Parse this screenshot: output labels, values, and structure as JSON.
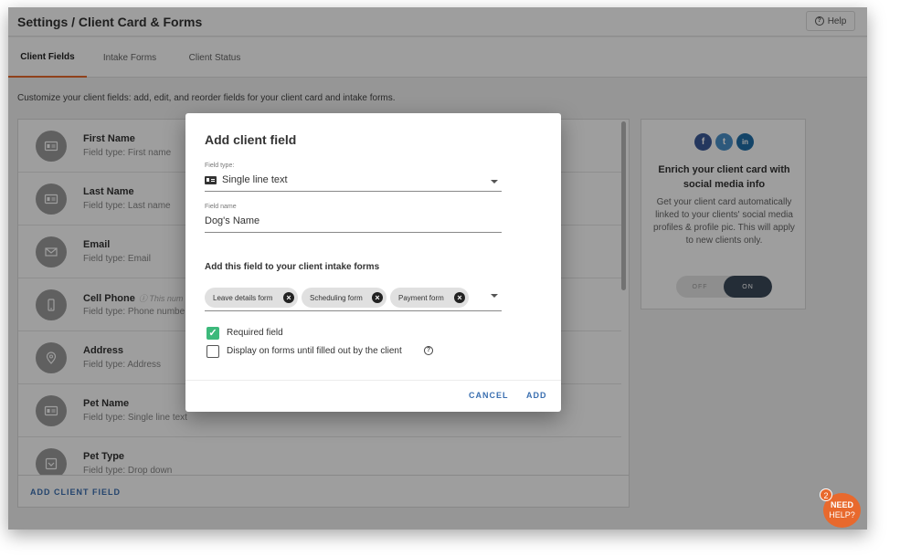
{
  "header": {
    "title": "Settings / Client Card & Forms",
    "help_label": "Help"
  },
  "tabs": [
    {
      "label": "Client Fields",
      "active": true
    },
    {
      "label": "Intake Forms",
      "active": false
    },
    {
      "label": "Client Status",
      "active": false
    }
  ],
  "intro_text": "Customize your client fields: add, edit, and reorder fields for your client card and intake forms.",
  "fields": [
    {
      "name": "First Name",
      "type": "Field type: First name",
      "icon": "id-card-icon"
    },
    {
      "name": "Last Name",
      "type": "Field type: Last name",
      "icon": "id-card-icon"
    },
    {
      "name": "Email",
      "type": "Field type: Email",
      "icon": "envelope-icon"
    },
    {
      "name": "Cell Phone",
      "note": "This num",
      "type": "Field type: Phone numbe",
      "icon": "phone-icon"
    },
    {
      "name": "Address",
      "type": "Field type: Address",
      "icon": "map-pin-icon"
    },
    {
      "name": "Pet Name",
      "type": "Field type: Single line text",
      "icon": "id-card-icon"
    },
    {
      "name": "Pet Type",
      "type": "Field type: Drop down",
      "icon": "dropdown-icon"
    }
  ],
  "add_field_label": "ADD CLIENT FIELD",
  "social_card": {
    "title": "Enrich your client card with social media info",
    "description": "Get your client card automatically linked to your clients' social media profiles & profile pic. This will apply to new clients only.",
    "toggle_off": "OFF",
    "toggle_on": "ON",
    "icons": [
      {
        "glyph": "f",
        "name": "facebook-icon",
        "color": "#3b5998"
      },
      {
        "glyph": "t",
        "name": "twitter-icon",
        "color": "#4a90c9"
      },
      {
        "glyph": "in",
        "name": "linkedin-icon",
        "color": "#1f6fa8"
      }
    ]
  },
  "modal": {
    "title": "Add client field",
    "field_type_label": "Field type:",
    "field_type_value": "Single line text",
    "field_name_label": "Field name",
    "field_name_value": "Dog's Name",
    "forms_section_label": "Add this field to your client intake forms",
    "chips": [
      "Leave details form",
      "Scheduling form",
      "Payment form"
    ],
    "required_label": "Required field",
    "display_label": "Display on forms until filled out by the client",
    "cancel_label": "CANCEL",
    "add_label": "ADD"
  },
  "need_help": {
    "line1": "NEED",
    "line2": "HELP?",
    "badge_count": "2"
  },
  "colors": {
    "accent": "#e8692d",
    "link": "#3a6fb0",
    "check": "#3cb97b"
  }
}
